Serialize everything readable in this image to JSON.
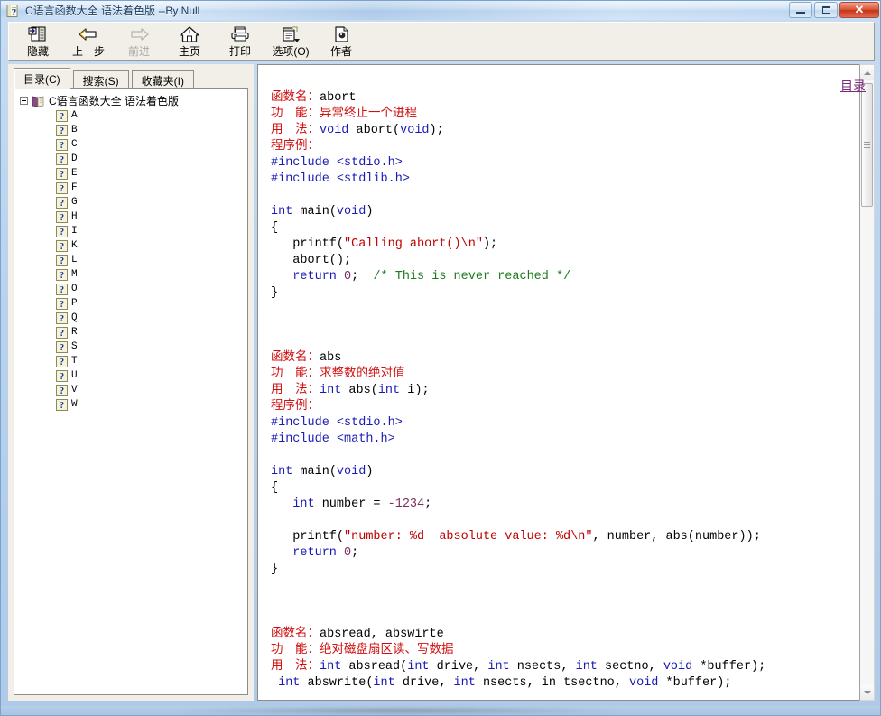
{
  "window": {
    "title": "C语言函数大全 语法着色版 --By Null",
    "icon": "help-book-question-icon",
    "controls": {
      "minimize": "minimize-button",
      "maximize": "maximize-button",
      "close": "✕"
    }
  },
  "toolbar": {
    "buttons": [
      {
        "label": "隐藏",
        "icon": "hide-pane-icon",
        "disabled": false
      },
      {
        "label": "上一步",
        "icon": "back-arrow-icon",
        "disabled": false
      },
      {
        "label": "前进",
        "icon": "forward-arrow-icon",
        "disabled": true
      },
      {
        "label": "主页",
        "icon": "home-icon",
        "disabled": false
      },
      {
        "label": "打印",
        "icon": "printer-icon",
        "disabled": false
      },
      {
        "label": "选项(O)",
        "icon": "options-icon",
        "disabled": false
      },
      {
        "label": "作者",
        "icon": "author-page-icon",
        "disabled": false
      }
    ]
  },
  "nav": {
    "tabs": [
      {
        "label": "目录(C)",
        "active": true
      },
      {
        "label": "搜索(S)",
        "active": false
      },
      {
        "label": "收藏夹(I)",
        "active": false
      }
    ],
    "tree": {
      "root": "C语言函数大全 语法着色版",
      "items": [
        "A",
        "B",
        "C",
        "D",
        "E",
        "F",
        "G",
        "H",
        "I",
        "K",
        "L",
        "M",
        "O",
        "P",
        "Q",
        "R",
        "S",
        "T",
        "U",
        "V",
        "W"
      ]
    }
  },
  "content": {
    "toc_link": "目录",
    "entries": [
      {
        "name_label": "函数名：",
        "name_value": "abort",
        "func_label": "功　能：",
        "func_value": "异常终止一个进程",
        "usage_label": "用　法：",
        "usage_value": "void abort(void);",
        "example_label": "程序例："
      },
      {
        "name_label": "函数名：",
        "name_value": "abs",
        "func_label": "功　能：",
        "func_value": "求整数的绝对值",
        "usage_label": "用　法：",
        "usage_value": "int abs(int i);",
        "example_label": "程序例："
      },
      {
        "name_label": "函数名：",
        "name_value": "absread, abswirte",
        "func_label": "功　能：",
        "func_value": "绝对磁盘扇区读、写数据",
        "usage_label": "用　法：",
        "usage_value": "int absread(int drive, int nsects, int sectno, void *buffer);",
        "usage_value2": "int abswrite(int drive, int nsects, in tsectno, void *buffer);"
      }
    ],
    "code1": [
      "#include <stdio.h>",
      "#include <stdlib.h>",
      "",
      "int main(void)",
      "{",
      "   printf(\"Calling abort()\\n\");",
      "   abort();",
      "   return 0;  /* This is never reached */",
      "}"
    ],
    "code2": [
      "#include <stdio.h>",
      "#include <math.h>",
      "",
      "int main(void)",
      "{",
      "   int number = -1234;",
      "",
      "   printf(\"number: %d  absolute value: %d\\n\", number, abs(number));",
      "   return 0;",
      "}"
    ]
  },
  "scrollbar": {
    "up_arrow": "scroll-up-arrow",
    "down_arrow": "scroll-down-arrow",
    "thumb": "scroll-thumb"
  },
  "colors": {
    "keyword": "#1a1ab5",
    "string": "#c00000",
    "comment": "#1a7a1a",
    "number": "#7b2d5e",
    "label": "#d01010",
    "link": "#7a2a78"
  }
}
